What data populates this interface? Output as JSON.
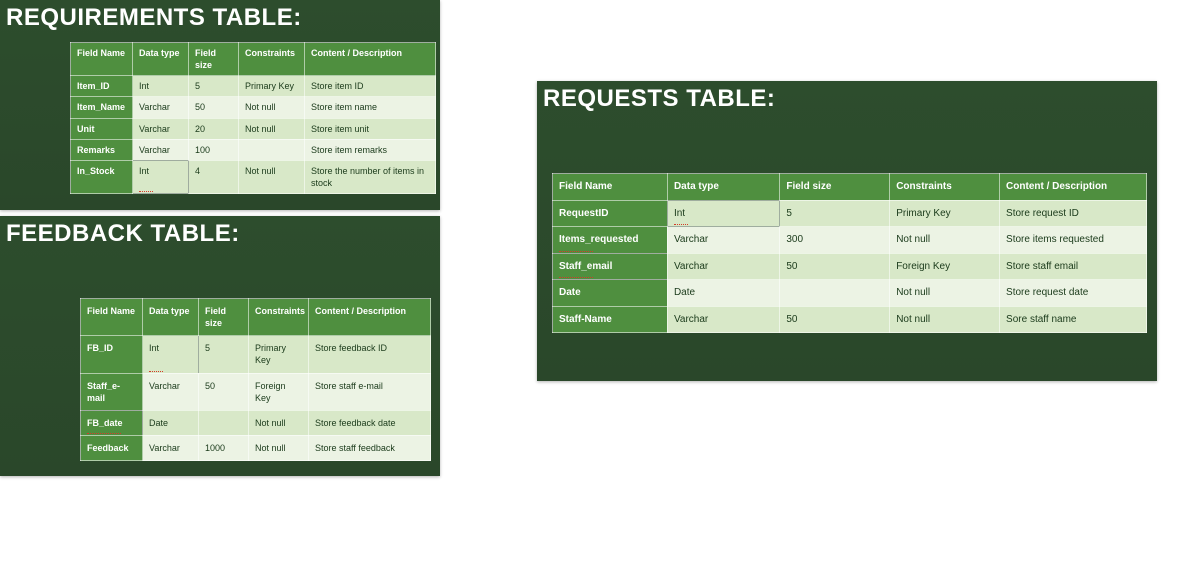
{
  "requirements": {
    "title": "REQUIREMENTS TABLE:",
    "columns": [
      "Field Name",
      "Data type",
      "Field size",
      "Constraints",
      "Content / Description"
    ],
    "rows": [
      {
        "field": "Item_ID",
        "type": "Int",
        "size": "5",
        "constraints": "Primary Key",
        "desc": "Store item ID",
        "type_flag": false,
        "field_flag": false
      },
      {
        "field": "Item_Name",
        "type": "Varchar",
        "size": "50",
        "constraints": "Not null",
        "desc": "Store item name",
        "type_flag": false,
        "field_flag": false
      },
      {
        "field": "Unit",
        "type": "Varchar",
        "size": "20",
        "constraints": "Not null",
        "desc": "Store item unit",
        "type_flag": false,
        "field_flag": false
      },
      {
        "field": "Remarks",
        "type": "Varchar",
        "size": "100",
        "constraints": "",
        "desc": "Store item remarks",
        "type_flag": false,
        "field_flag": false
      },
      {
        "field": "In_Stock",
        "type": "Int",
        "size": "4",
        "constraints": "Not null",
        "desc": "Store the number of items in stock",
        "type_flag": true,
        "field_flag": false
      }
    ]
  },
  "feedback": {
    "title": "FEEDBACK TABLE:",
    "columns": [
      "Field Name",
      "Data type",
      "Field size",
      "Constraints",
      "Content / Description"
    ],
    "rows": [
      {
        "field": "FB_ID",
        "type": "Int",
        "size": "5",
        "constraints": "Primary Key",
        "desc": "Store feedback ID",
        "type_flag": true,
        "field_flag": false
      },
      {
        "field": "Staff_e-mail",
        "type": "Varchar",
        "size": "50",
        "constraints": "Foreign Key",
        "desc": "Store staff e-mail",
        "type_flag": false,
        "field_flag": false
      },
      {
        "field": "FB_date",
        "type": "Date",
        "size": "",
        "constraints": "Not null",
        "desc": "Store feedback date",
        "type_flag": false,
        "field_flag": true
      },
      {
        "field": "Feedback",
        "type": "Varchar",
        "size": "1000",
        "constraints": "Not null",
        "desc": "Store staff feedback",
        "type_flag": false,
        "field_flag": false
      }
    ]
  },
  "requests": {
    "title": "REQUESTS TABLE:",
    "columns": [
      "Field Name",
      "Data type",
      "Field size",
      "Constraints",
      "Content / Description"
    ],
    "rows": [
      {
        "field": "RequestID",
        "type": "Int",
        "size": "5",
        "constraints": "Primary Key",
        "desc": "Store request ID",
        "type_flag": true,
        "field_flag": false
      },
      {
        "field": "Items_requested",
        "type": "Varchar",
        "size": "300",
        "constraints": "Not null",
        "desc": "Store items requested",
        "type_flag": false,
        "field_flag": true
      },
      {
        "field": "Staff_email",
        "type": "Varchar",
        "size": "50",
        "constraints": "Foreign Key",
        "desc": "Store staff email",
        "type_flag": false,
        "field_flag": true
      },
      {
        "field": "Date",
        "type": "Date",
        "size": "",
        "constraints": "Not null",
        "desc": "Store request date",
        "type_flag": false,
        "field_flag": false
      },
      {
        "field": "Staff-Name",
        "type": "Varchar",
        "size": "50",
        "constraints": "Not null",
        "desc": "Sore staff name",
        "type_flag": false,
        "field_flag": false
      }
    ]
  }
}
